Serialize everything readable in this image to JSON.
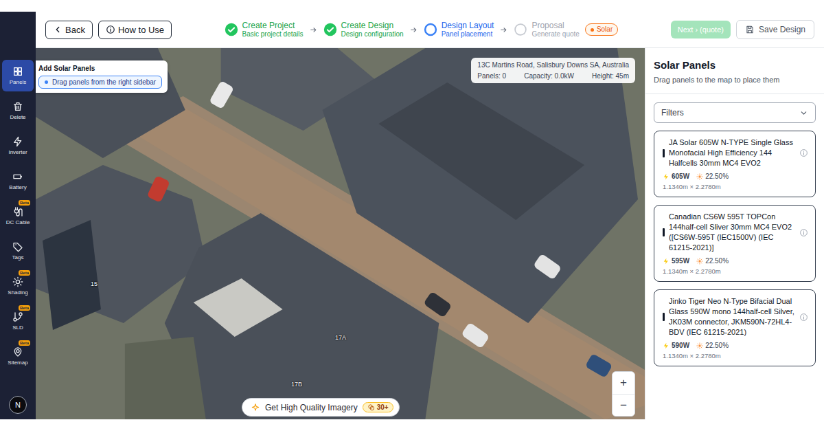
{
  "header": {
    "back": "Back",
    "howTo": "How to Use",
    "steps": [
      {
        "title": "Create Project",
        "subtitle": "Basic project details",
        "status": "done"
      },
      {
        "title": "Create Design",
        "subtitle": "Design configuration",
        "status": "done"
      },
      {
        "title": "Design Layout",
        "subtitle": "Panel placement",
        "status": "current"
      },
      {
        "title": "Proposal",
        "subtitle": "Generate quote",
        "status": "pending"
      }
    ],
    "badge": "Solar",
    "next": {
      "label": "Next › (quote)",
      "disabled": true
    },
    "save": "Save Design"
  },
  "sidebar": {
    "items": [
      {
        "label": "Panels",
        "selected": true
      },
      {
        "label": "Delete",
        "selected": false
      },
      {
        "label": "Inverter",
        "selected": false
      },
      {
        "label": "Battery",
        "selected": false
      },
      {
        "label": "DC Cable",
        "selected": false,
        "badge": "Beta"
      },
      {
        "label": "Tags",
        "selected": false
      },
      {
        "label": "Shading",
        "selected": false,
        "badge": "Beta"
      },
      {
        "label": "SLD",
        "selected": false,
        "badge": "Beta"
      },
      {
        "label": "Sitemap",
        "selected": false,
        "badge": "Beta"
      }
    ],
    "avatar": "N"
  },
  "map": {
    "toolCard": {
      "title": "Add Solar Panels",
      "hint": "Drag panels from the right sidebar"
    },
    "info": {
      "address": "13C Martins Road, Salisbury Downs SA, Australia",
      "stats": [
        "Panels: 0",
        "Capacity: 0.0kW",
        "Height: 45m"
      ]
    },
    "labels": [
      {
        "text": "15"
      },
      {
        "text": "17A"
      },
      {
        "text": "17B"
      }
    ],
    "imagery": {
      "label": "Get High Quality Imagery",
      "credits": "30+"
    },
    "zoom": [
      "+",
      "−"
    ]
  },
  "panel": {
    "title": "Solar Panels",
    "subtitle": "Drag panels to the map to place them",
    "filter": "Filters",
    "products": [
      {
        "name": "JA Solar 605W N-TYPE Single Glass Monofacial High Efficiency 144 Halfcells 30mm MC4 EVO2",
        "power": "605W",
        "efficiency": "22.50%",
        "size": "1.1340m × 2.2780m"
      },
      {
        "name": "Canadian CS6W 595T TOPCon 144half-cell Sliver 30mm MC4 EVO2 ([CS6W-595T (IEC1500V) (IEC 61215-2021)]",
        "power": "595W",
        "efficiency": "22.50%",
        "size": "1.1340m × 2.2780m"
      },
      {
        "name": "Jinko Tiger Neo N-Type Bifacial Dual Glass 590W mono 144half-cell Silver, JK03M connector, JKM590N-72HL4-BDV (IEC 61215-2021)",
        "power": "590W",
        "efficiency": "22.50%",
        "size": "1.1340m × 2.2780m"
      }
    ]
  }
}
